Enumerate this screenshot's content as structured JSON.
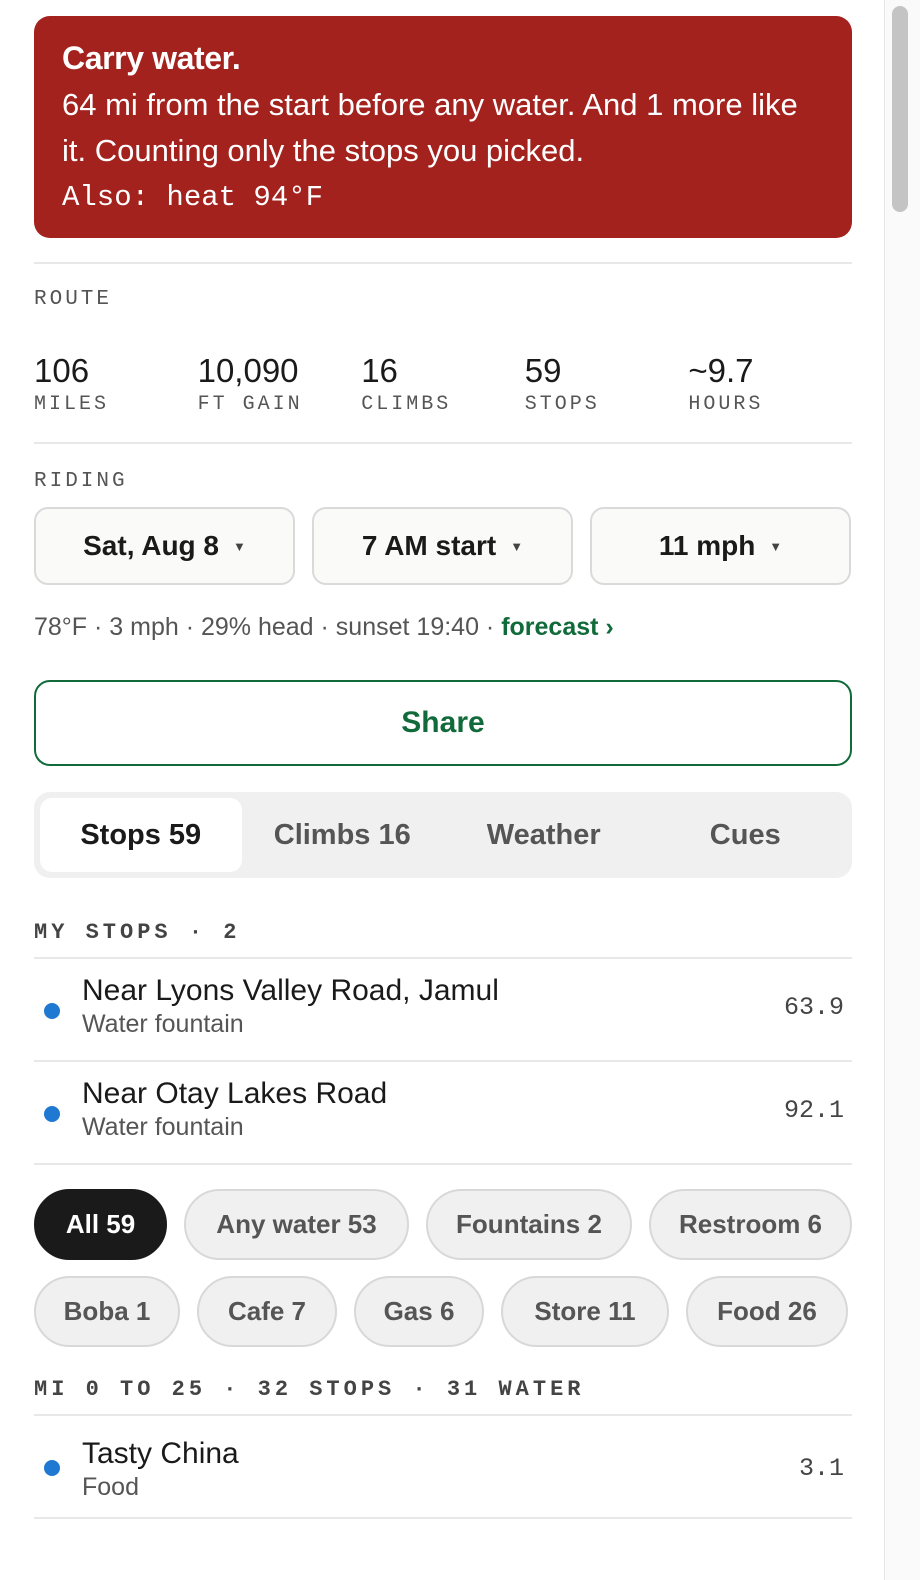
{
  "alert": {
    "title": "Carry water.",
    "body": "64 mi from the start before any water. And 1 more like it. Counting only the stops you picked.",
    "also": "Also: heat 94°F"
  },
  "route": {
    "label": "ROUTE",
    "stats": [
      {
        "value": "106",
        "label": "MILES"
      },
      {
        "value": "10,090",
        "label": "FT GAIN"
      },
      {
        "value": "16",
        "label": "CLIMBS"
      },
      {
        "value": "59",
        "label": "STOPS"
      },
      {
        "value": "~9.7",
        "label": "HOURS"
      }
    ]
  },
  "riding": {
    "label": "RIDING",
    "date": "Sat, Aug 8",
    "start": "7 AM start",
    "speed": "11 mph",
    "caret": "▼",
    "weather_summary": "78°F · 3 mph · 29% head · sunset 19:40 · ",
    "forecast_link": "forecast ›"
  },
  "share": {
    "label": "Share"
  },
  "tabs": [
    {
      "label": "Stops 59",
      "active": true
    },
    {
      "label": "Climbs 16"
    },
    {
      "label": "Weather"
    },
    {
      "label": "Cues"
    }
  ],
  "my_stops": {
    "heading": "MY STOPS · 2",
    "items": [
      {
        "name": "Near Lyons Valley Road, Jamul",
        "type": "Water fountain",
        "mile": "63.9"
      },
      {
        "name": "Near Otay Lakes Road",
        "type": "Water fountain",
        "mile": "92.1"
      }
    ]
  },
  "filters": {
    "row1": [
      "All 59",
      "Any water 53",
      "Fountains 2",
      "Restroom 6"
    ],
    "row2": [
      "Boba 1",
      "Cafe 7",
      "Gas 6",
      "Store 11",
      "Food 26"
    ],
    "active": "All 59"
  },
  "group": {
    "heading": "MI 0 TO 25 · 32 STOPS · 31 WATER",
    "items": [
      {
        "name": "Tasty China",
        "type": "Food",
        "mile": "3.1"
      }
    ]
  },
  "colors": {
    "alert_bg": "#a3221e",
    "accent_green": "#116a3a",
    "stop_dot": "#1f78d1"
  },
  "icons": {
    "dropdown": "caret-down-icon",
    "stop_marker": "stop-dot-icon"
  }
}
